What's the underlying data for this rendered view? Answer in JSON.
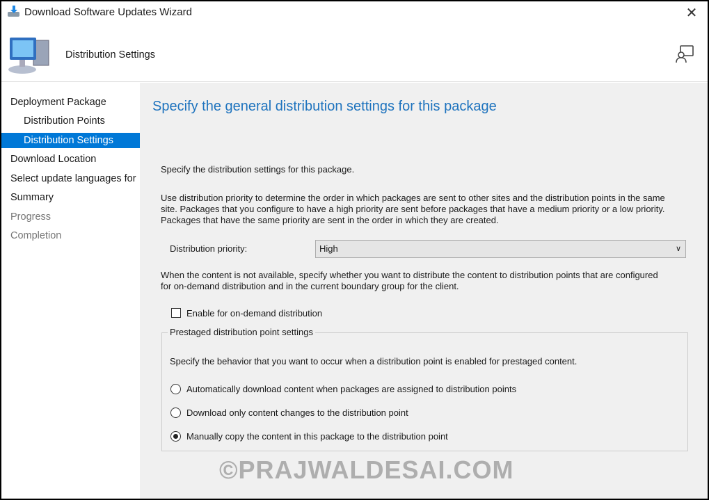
{
  "window": {
    "title": "Download Software Updates Wizard",
    "close": "✕"
  },
  "header": {
    "page_title": "Distribution Settings"
  },
  "nav": {
    "items": [
      {
        "label": "Deployment Package",
        "state": "normal"
      },
      {
        "label": "Distribution Points",
        "state": "normal"
      },
      {
        "label": "Distribution Settings",
        "state": "selected"
      },
      {
        "label": "Download Location",
        "state": "normal"
      },
      {
        "label": "Select update languages for",
        "state": "normal"
      },
      {
        "label": "Summary",
        "state": "normal"
      },
      {
        "label": "Progress",
        "state": "disabled"
      },
      {
        "label": "Completion",
        "state": "disabled"
      }
    ]
  },
  "main": {
    "heading": "Specify the general distribution settings for this package",
    "intro": "Specify the distribution settings for this package.",
    "priority_desc": [
      "Use distribution priority to determine the order in which packages are sent to other sites and the distribution points in the same",
      "site. Packages that you configure to have a high priority are sent before packages that have a medium priority or a low priority.",
      "Packages that have the same priority are sent in the order in which they are created."
    ],
    "priority_label": "Distribution priority:",
    "priority_value": "High",
    "ondemand_desc": [
      "When the content is not available, specify whether you want to distribute the content to distribution points that are configured",
      "for on-demand distribution and in the current boundary group for the client."
    ],
    "ondemand_checkbox": {
      "label": "Enable for on-demand distribution",
      "checked": false
    },
    "prestaged": {
      "group_label": "Prestaged distribution point settings",
      "desc": "Specify the behavior that you want to occur when a distribution point is enabled for prestaged content.",
      "options": [
        {
          "label": "Automatically download content when packages are assigned to distribution points",
          "selected": false
        },
        {
          "label": "Download only content changes to the distribution point",
          "selected": false
        },
        {
          "label": "Manually copy the content in this package to the distribution point",
          "selected": true
        }
      ]
    }
  },
  "watermark": "©PRAJWALDESAI.COM",
  "colors": {
    "accent": "#0078d7",
    "heading": "#1e73be",
    "panel": "#f0f0f0"
  }
}
